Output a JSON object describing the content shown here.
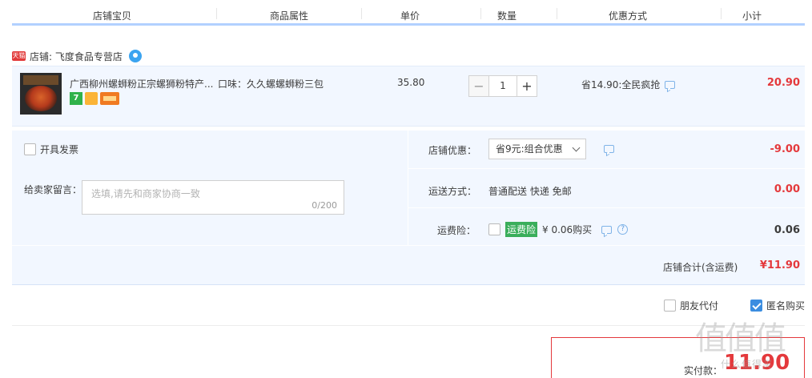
{
  "columns": [
    "店铺宝贝",
    "商品属性",
    "单价",
    "数量",
    "优惠方式",
    "小计"
  ],
  "shop": {
    "tag": "天猫",
    "name": "店铺: 飞度食品专营店"
  },
  "item": {
    "title": "广西柳州螺蛳粉正宗螺狮粉特产...",
    "property": "口味：久久螺螺蛳粉三包",
    "price": "35.80",
    "badge_7": "7",
    "qty_minus": "−",
    "qty_plus": "+",
    "quantity": "1",
    "promo": "省14.90:全民疯抢",
    "subtotal": "20.90"
  },
  "options": {
    "invoice_label": "开具发票",
    "message_label": "给卖家留言：",
    "message_placeholder": "选填,请先和商家协商一致",
    "message_count": "0/200",
    "shop_discount_label": "店铺优惠：",
    "shop_discount_selected": "省9元:组合优惠",
    "shop_discount_value": "-9.00",
    "shipping_label": "运送方式：",
    "shipping_text": "普通配送 快递 免邮",
    "shipping_value": "0.00",
    "insurance_label": "运费险：",
    "insurance_tag": "运费险",
    "insurance_text": "¥ 0.06购买",
    "insurance_value": "0.06",
    "shop_total_label": "店铺合计(含运费)",
    "shop_total_value": "¥11.90"
  },
  "bottom": {
    "friend_pay_label": "朋友代付",
    "friend_pay_checked": false,
    "anonymous_label": "匿名购买",
    "anonymous_checked": true
  },
  "payment": {
    "label": "实付款：",
    "value": "11.90"
  },
  "watermark": {
    "text": "值值值",
    "url": "什么值得买"
  },
  "colors": {
    "accent": "#e4393c",
    "header_line": "#b2d1ff",
    "row_bg": "#f2f7ff"
  }
}
